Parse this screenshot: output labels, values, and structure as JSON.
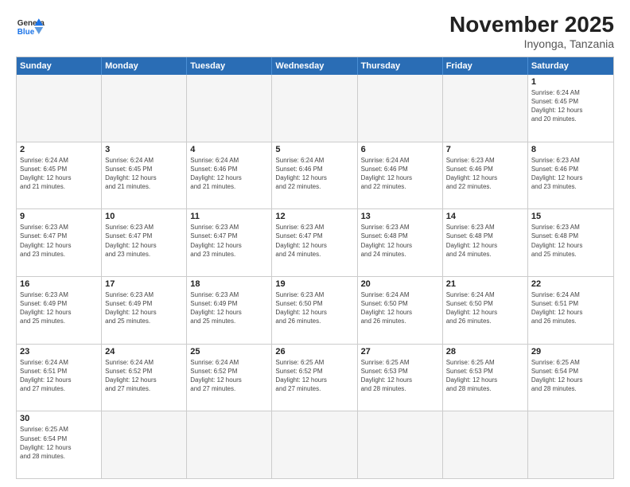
{
  "header": {
    "logo_general": "General",
    "logo_blue": "Blue",
    "month_title": "November 2025",
    "location": "Inyonga, Tanzania"
  },
  "days_of_week": [
    "Sunday",
    "Monday",
    "Tuesday",
    "Wednesday",
    "Thursday",
    "Friday",
    "Saturday"
  ],
  "weeks": [
    [
      {
        "day": "",
        "text": ""
      },
      {
        "day": "",
        "text": ""
      },
      {
        "day": "",
        "text": ""
      },
      {
        "day": "",
        "text": ""
      },
      {
        "day": "",
        "text": ""
      },
      {
        "day": "",
        "text": ""
      },
      {
        "day": "1",
        "text": "Sunrise: 6:24 AM\nSunset: 6:45 PM\nDaylight: 12 hours\nand 20 minutes."
      }
    ],
    [
      {
        "day": "2",
        "text": "Sunrise: 6:24 AM\nSunset: 6:45 PM\nDaylight: 12 hours\nand 21 minutes."
      },
      {
        "day": "3",
        "text": "Sunrise: 6:24 AM\nSunset: 6:45 PM\nDaylight: 12 hours\nand 21 minutes."
      },
      {
        "day": "4",
        "text": "Sunrise: 6:24 AM\nSunset: 6:46 PM\nDaylight: 12 hours\nand 21 minutes."
      },
      {
        "day": "5",
        "text": "Sunrise: 6:24 AM\nSunset: 6:46 PM\nDaylight: 12 hours\nand 22 minutes."
      },
      {
        "day": "6",
        "text": "Sunrise: 6:24 AM\nSunset: 6:46 PM\nDaylight: 12 hours\nand 22 minutes."
      },
      {
        "day": "7",
        "text": "Sunrise: 6:23 AM\nSunset: 6:46 PM\nDaylight: 12 hours\nand 22 minutes."
      },
      {
        "day": "8",
        "text": "Sunrise: 6:23 AM\nSunset: 6:46 PM\nDaylight: 12 hours\nand 23 minutes."
      }
    ],
    [
      {
        "day": "9",
        "text": "Sunrise: 6:23 AM\nSunset: 6:47 PM\nDaylight: 12 hours\nand 23 minutes."
      },
      {
        "day": "10",
        "text": "Sunrise: 6:23 AM\nSunset: 6:47 PM\nDaylight: 12 hours\nand 23 minutes."
      },
      {
        "day": "11",
        "text": "Sunrise: 6:23 AM\nSunset: 6:47 PM\nDaylight: 12 hours\nand 23 minutes."
      },
      {
        "day": "12",
        "text": "Sunrise: 6:23 AM\nSunset: 6:47 PM\nDaylight: 12 hours\nand 24 minutes."
      },
      {
        "day": "13",
        "text": "Sunrise: 6:23 AM\nSunset: 6:48 PM\nDaylight: 12 hours\nand 24 minutes."
      },
      {
        "day": "14",
        "text": "Sunrise: 6:23 AM\nSunset: 6:48 PM\nDaylight: 12 hours\nand 24 minutes."
      },
      {
        "day": "15",
        "text": "Sunrise: 6:23 AM\nSunset: 6:48 PM\nDaylight: 12 hours\nand 25 minutes."
      }
    ],
    [
      {
        "day": "16",
        "text": "Sunrise: 6:23 AM\nSunset: 6:49 PM\nDaylight: 12 hours\nand 25 minutes."
      },
      {
        "day": "17",
        "text": "Sunrise: 6:23 AM\nSunset: 6:49 PM\nDaylight: 12 hours\nand 25 minutes."
      },
      {
        "day": "18",
        "text": "Sunrise: 6:23 AM\nSunset: 6:49 PM\nDaylight: 12 hours\nand 25 minutes."
      },
      {
        "day": "19",
        "text": "Sunrise: 6:23 AM\nSunset: 6:50 PM\nDaylight: 12 hours\nand 26 minutes."
      },
      {
        "day": "20",
        "text": "Sunrise: 6:24 AM\nSunset: 6:50 PM\nDaylight: 12 hours\nand 26 minutes."
      },
      {
        "day": "21",
        "text": "Sunrise: 6:24 AM\nSunset: 6:50 PM\nDaylight: 12 hours\nand 26 minutes."
      },
      {
        "day": "22",
        "text": "Sunrise: 6:24 AM\nSunset: 6:51 PM\nDaylight: 12 hours\nand 26 minutes."
      }
    ],
    [
      {
        "day": "23",
        "text": "Sunrise: 6:24 AM\nSunset: 6:51 PM\nDaylight: 12 hours\nand 27 minutes."
      },
      {
        "day": "24",
        "text": "Sunrise: 6:24 AM\nSunset: 6:52 PM\nDaylight: 12 hours\nand 27 minutes."
      },
      {
        "day": "25",
        "text": "Sunrise: 6:24 AM\nSunset: 6:52 PM\nDaylight: 12 hours\nand 27 minutes."
      },
      {
        "day": "26",
        "text": "Sunrise: 6:25 AM\nSunset: 6:52 PM\nDaylight: 12 hours\nand 27 minutes."
      },
      {
        "day": "27",
        "text": "Sunrise: 6:25 AM\nSunset: 6:53 PM\nDaylight: 12 hours\nand 28 minutes."
      },
      {
        "day": "28",
        "text": "Sunrise: 6:25 AM\nSunset: 6:53 PM\nDaylight: 12 hours\nand 28 minutes."
      },
      {
        "day": "29",
        "text": "Sunrise: 6:25 AM\nSunset: 6:54 PM\nDaylight: 12 hours\nand 28 minutes."
      }
    ],
    [
      {
        "day": "30",
        "text": "Sunrise: 6:25 AM\nSunset: 6:54 PM\nDaylight: 12 hours\nand 28 minutes."
      },
      {
        "day": "",
        "text": ""
      },
      {
        "day": "",
        "text": ""
      },
      {
        "day": "",
        "text": ""
      },
      {
        "day": "",
        "text": ""
      },
      {
        "day": "",
        "text": ""
      },
      {
        "day": "",
        "text": ""
      }
    ]
  ]
}
